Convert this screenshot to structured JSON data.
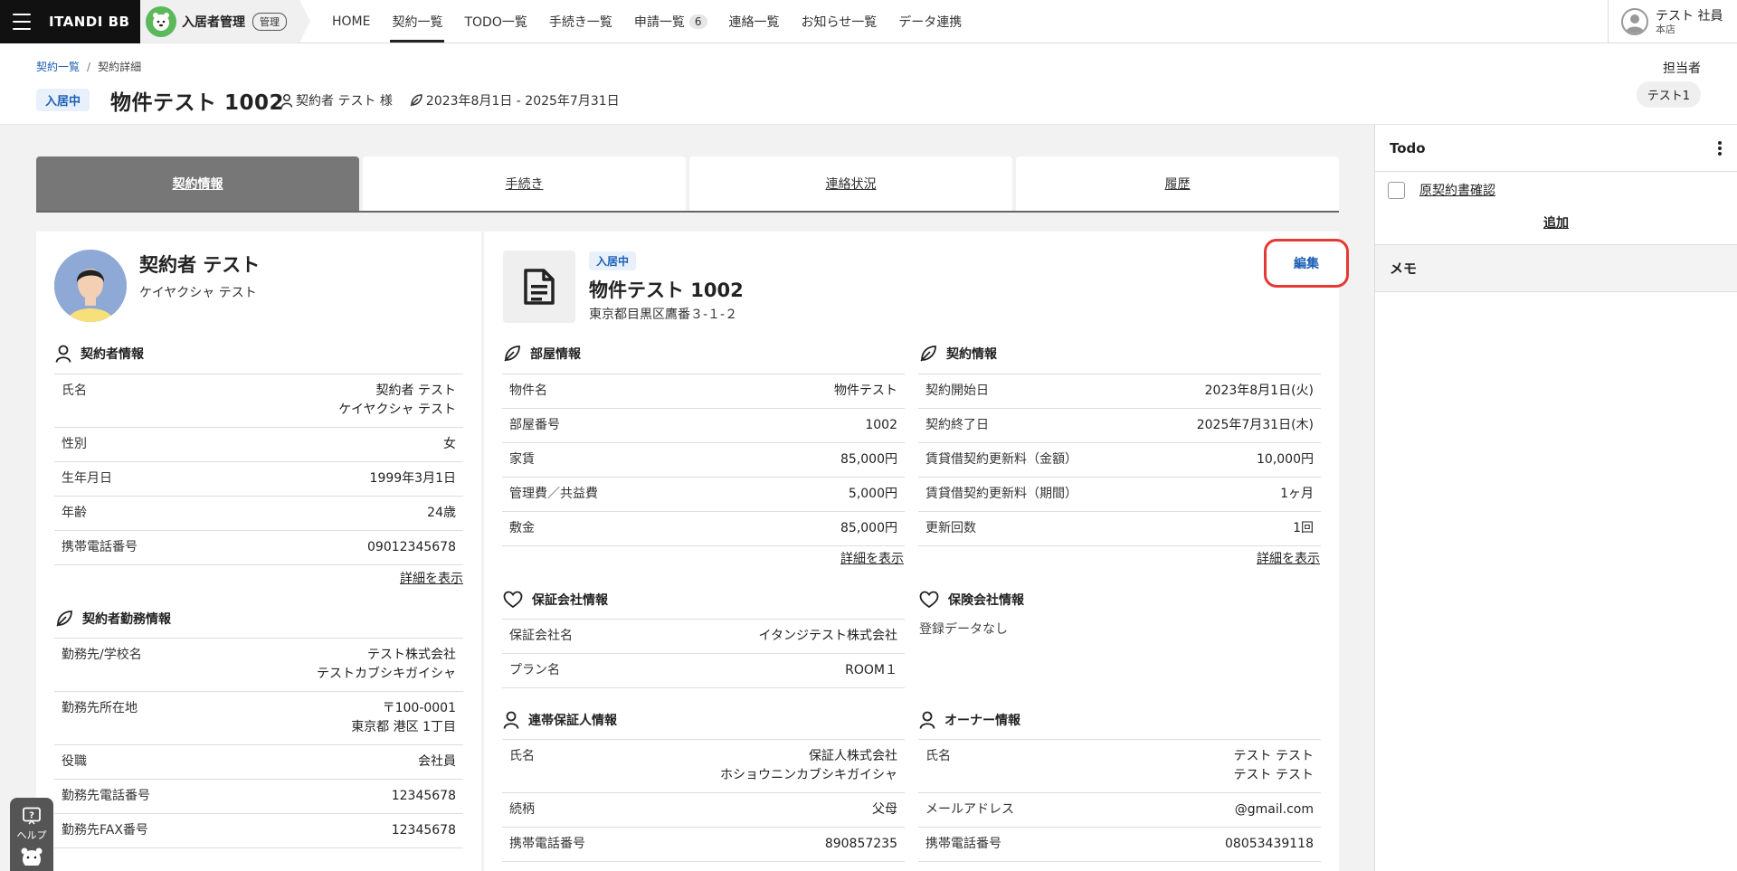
{
  "topbar": {
    "brand": "ITANDI BB",
    "app_name": "入居者管理",
    "admin_badge": "管理",
    "nav": [
      {
        "label": "HOME"
      },
      {
        "label": "契約一覧"
      },
      {
        "label": "TODO一覧"
      },
      {
        "label": "手続き一覧"
      },
      {
        "label": "申請一覧",
        "count": "6"
      },
      {
        "label": "連絡一覧"
      },
      {
        "label": "お知らせ一覧"
      },
      {
        "label": "データ連携"
      }
    ],
    "active_nav": "契約一覧",
    "user_name": "テスト 社員",
    "user_branch": "本店"
  },
  "header": {
    "breadcrumb": [
      "契約一覧",
      "契約詳細"
    ],
    "status": "入居中",
    "title": "物件テスト 1002",
    "contractor": "契約者 テスト 様",
    "period": "2023年8月1日 - 2025年7月31日",
    "owner_label": "担当者",
    "owner_chip": "テスト1"
  },
  "tabs": [
    "契約情報",
    "手続き",
    "連絡状況",
    "履歴"
  ],
  "active_tab": "契約情報",
  "profile": {
    "name": "契約者 テスト",
    "kana": "ケイヤクシャ テスト",
    "contractor_info": {
      "title": "契約者情報",
      "rows": [
        {
          "k": "氏名",
          "v": "契約者 テスト",
          "v2": "ケイヤクシャ テスト"
        },
        {
          "k": "性別",
          "v": "女"
        },
        {
          "k": "生年月日",
          "v": "1999年3月1日"
        },
        {
          "k": "年齢",
          "v": "24歳"
        },
        {
          "k": "携帯電話番号",
          "v": "09012345678"
        }
      ],
      "more": "詳細を表示"
    },
    "work_info": {
      "title": "契約者勤務情報",
      "rows": [
        {
          "k": "勤務先/学校名",
          "v": "テスト株式会社",
          "v2": "テストカブシキガイシャ"
        },
        {
          "k": "勤務先所在地",
          "v": "〒100-0001",
          "v2": "東京都 港区 1丁目"
        },
        {
          "k": "役職",
          "v": "会社員"
        },
        {
          "k": "勤務先電話番号",
          "v": "12345678"
        },
        {
          "k": "勤務先FAX番号",
          "v": "12345678"
        }
      ]
    }
  },
  "property": {
    "status": "入居中",
    "title": "物件テスト 1002",
    "address": "東京都目黒区鷹番３-１-２",
    "edit": "編集",
    "room": {
      "title": "部屋情報",
      "rows": [
        {
          "k": "物件名",
          "v": "物件テスト"
        },
        {
          "k": "部屋番号",
          "v": "1002"
        },
        {
          "k": "家賃",
          "v": "85,000円"
        },
        {
          "k": "管理費／共益費",
          "v": "5,000円"
        },
        {
          "k": "敷金",
          "v": "85,000円"
        }
      ],
      "more": "詳細を表示"
    },
    "contract": {
      "title": "契約情報",
      "rows": [
        {
          "k": "契約開始日",
          "v": "2023年8月1日(火)"
        },
        {
          "k": "契約終了日",
          "v": "2025年7月31日(木)"
        },
        {
          "k": "賃貸借契約更新料（金額）",
          "v": "10,000円"
        },
        {
          "k": "賃貸借契約更新料（期間）",
          "v": "1ヶ月"
        },
        {
          "k": "更新回数",
          "v": "1回"
        }
      ],
      "more": "詳細を表示"
    },
    "guarantee": {
      "title": "保証会社情報",
      "rows": [
        {
          "k": "保証会社名",
          "v": "イタンジテスト株式会社"
        },
        {
          "k": "プラン名",
          "v": "ROOM１"
        }
      ]
    },
    "insurance": {
      "title": "保険会社情報",
      "empty": "登録データなし"
    },
    "guarantor": {
      "title": "連帯保証人情報",
      "rows": [
        {
          "k": "氏名",
          "v": "保証人株式会社",
          "v2": "ホショウニンカブシキガイシャ"
        },
        {
          "k": "続柄",
          "v": "父母"
        },
        {
          "k": "携帯電話番号",
          "v": "890857235"
        }
      ]
    },
    "owner": {
      "title": "オーナー情報",
      "rows": [
        {
          "k": "氏名",
          "v": "テスト テスト",
          "v2": "テスト テスト"
        },
        {
          "k": "メールアドレス",
          "v": "@gmail.com"
        },
        {
          "k": "携帯電話番号",
          "v": "08053439118"
        }
      ]
    }
  },
  "sidebar": {
    "todo_title": "Todo",
    "todo_items": [
      "原契約書確認"
    ],
    "add": "追加",
    "memo_title": "メモ"
  },
  "help": {
    "label": "ヘルプ"
  },
  "colors": {
    "accent": "#1a5fb4",
    "highlight": "#e53935",
    "tab_active": "#777777"
  }
}
